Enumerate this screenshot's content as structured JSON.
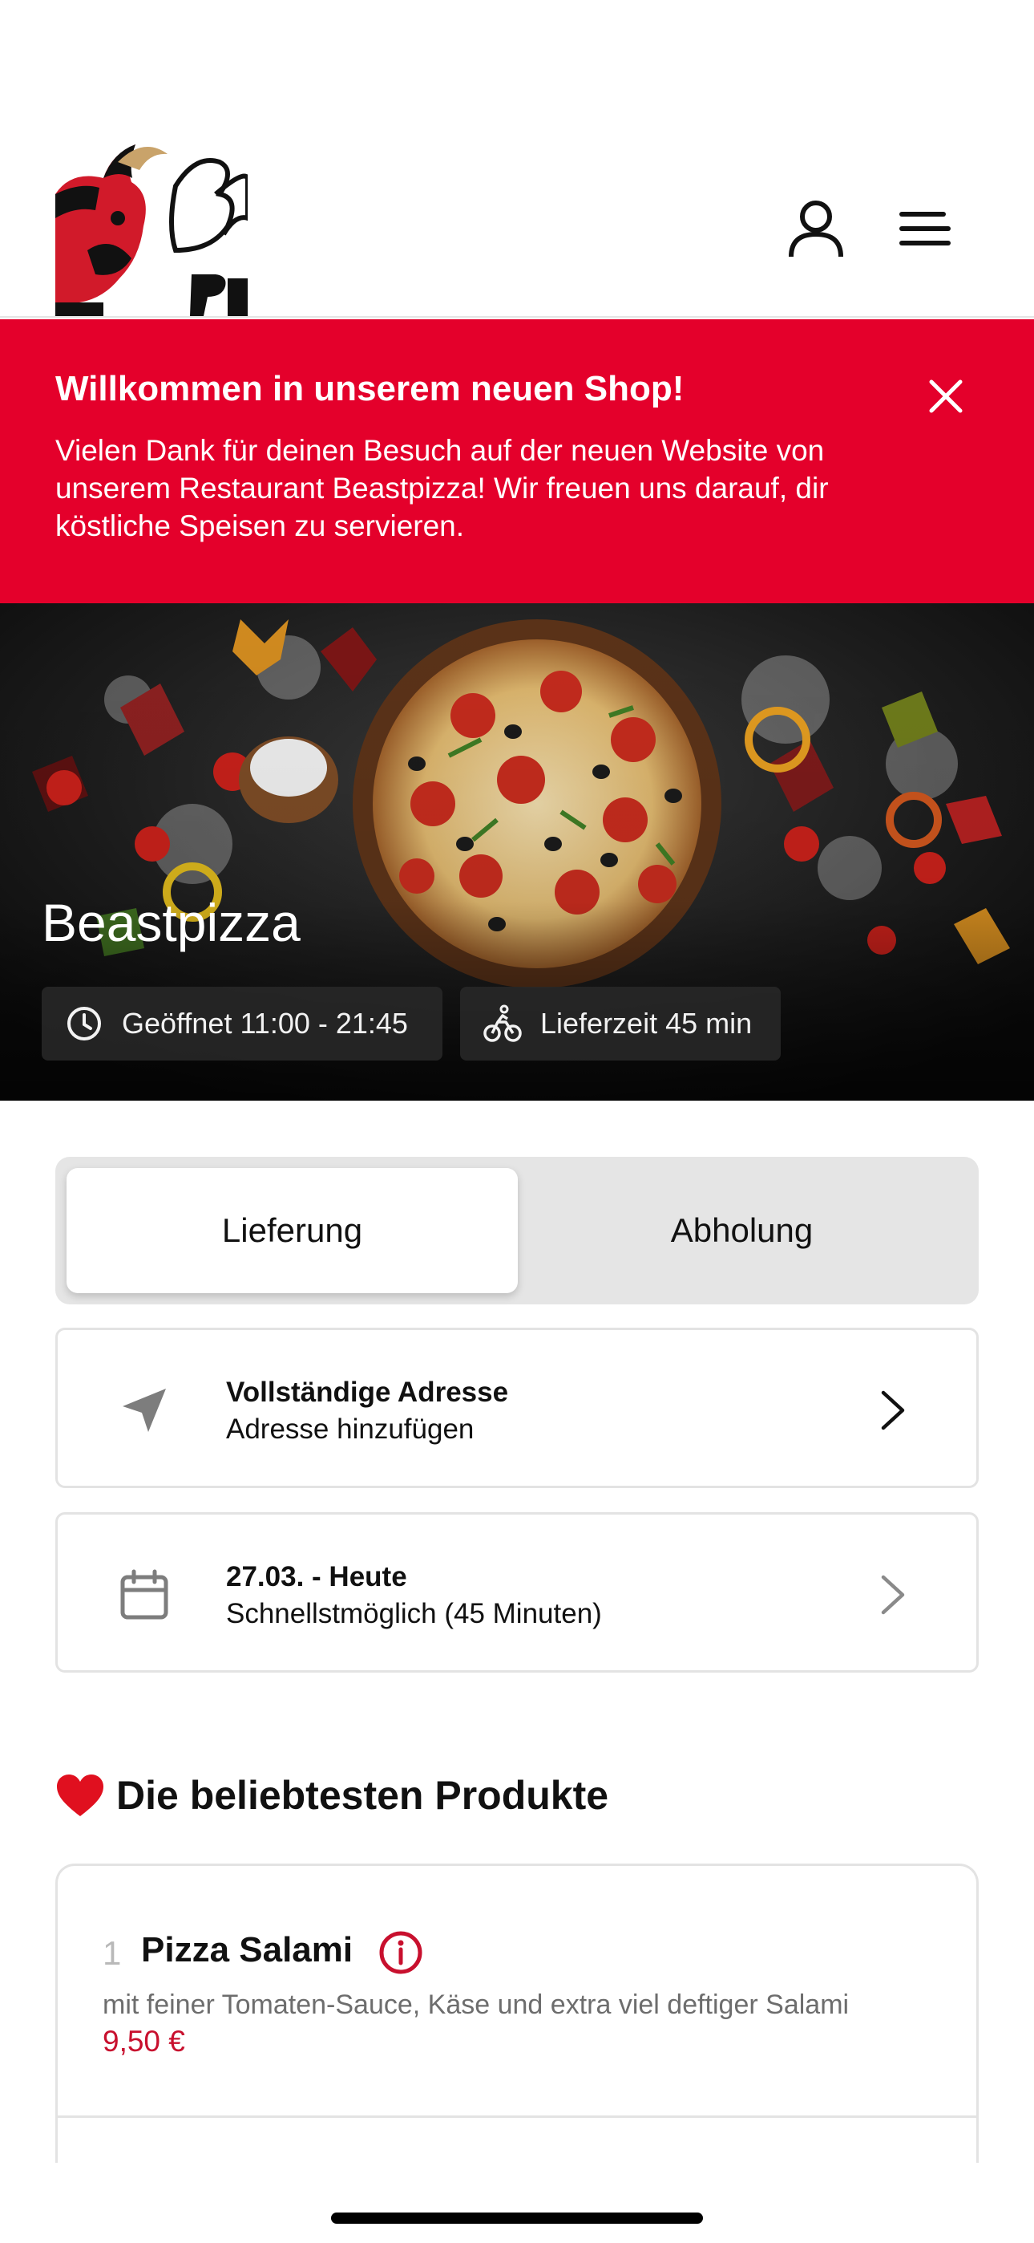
{
  "header": {
    "logo_text": "Beast Pizza",
    "user_icon": "user-icon",
    "menu_icon": "menu-icon"
  },
  "banner": {
    "title": "Willkommen in unserem neuen Shop!",
    "text": "Vielen Dank für deinen Besuch auf der neuen Website von unserem Restaurant Beastpizza! Wir freuen uns darauf, dir köstliche Speisen zu servieren.",
    "close_icon": "close-icon",
    "color": "#e4002b"
  },
  "hero": {
    "restaurant_name": "Beastpizza",
    "opening_hours": "Geöffnet 11:00 - 21:45",
    "delivery_time": "Lieferzeit 45 min"
  },
  "order_mode": {
    "options": [
      "Lieferung",
      "Abholung"
    ],
    "selected": "Lieferung"
  },
  "address": {
    "title": "Vollständige Adresse",
    "subtitle": "Adresse hinzufügen",
    "icon": "location-arrow-icon"
  },
  "schedule": {
    "title": "27.03. - Heute",
    "subtitle": "Schnellstmöglich (45 Minuten)",
    "icon": "calendar-icon"
  },
  "popular": {
    "title": "Die beliebtesten Produkte",
    "icon": "heart-icon",
    "products": [
      {
        "rank": "1",
        "name": "Pizza Salami",
        "description": "mit feiner Tomaten-Sauce, Käse und extra viel deftiger Salami",
        "price": "9,50 €"
      }
    ]
  },
  "accent_color": "#c8102e"
}
